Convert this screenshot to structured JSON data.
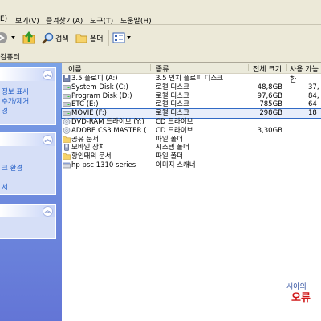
{
  "menu": {
    "items": [
      "E)",
      "보기(V)",
      "즐겨찾기(A)",
      "도구(T)",
      "도움말(H)"
    ]
  },
  "toolbar": {
    "search_label": "검색",
    "folders_label": "폴더"
  },
  "address": {
    "text": "컴퓨터"
  },
  "taskpane": {
    "panel1_links": [
      "정보 표시",
      "추가/제거",
      "경"
    ],
    "panel2_links": [
      "크 환경",
      "서"
    ]
  },
  "columns": {
    "name": "이름",
    "type": "종류",
    "total": "전체 크기",
    "free": "사용 가능한"
  },
  "rows": [
    {
      "name": "3.5 플로피 (A:)",
      "type": "3.5 인치 플로피 디스크",
      "total": "",
      "free": "",
      "icon": "floppy-icon"
    },
    {
      "name": "System Disk (C:)",
      "type": "로컬 디스크",
      "total": "48,8GB",
      "free": "37,",
      "icon": "hard-disk-icon"
    },
    {
      "name": "Program Disk (D:)",
      "type": "로컬 디스크",
      "total": "97,6GB",
      "free": "84,",
      "icon": "hard-disk-icon"
    },
    {
      "name": "ETC (E:)",
      "type": "로컬 디스크",
      "total": "785GB",
      "free": "64",
      "icon": "hard-disk-icon"
    },
    {
      "name": "MOVIE (F:)",
      "type": "로컬 디스크",
      "total": "298GB",
      "free": "18",
      "icon": "hard-disk-icon"
    },
    {
      "name": "DVD-RAM 드라이브 (Y:)",
      "type": "CD 드라이브",
      "total": "",
      "free": "",
      "icon": "cd-drive-icon"
    },
    {
      "name": "ADOBE CS3 MASTER (",
      "type": "CD 드라이브",
      "total": "3,30GB",
      "free": "",
      "icon": "cd-drive-icon"
    },
    {
      "name": "공유 문서",
      "type": "파일 폴더",
      "total": "",
      "free": "",
      "icon": "folder-icon"
    },
    {
      "name": "모바일 장치",
      "type": "시스템 폴더",
      "total": "",
      "free": "",
      "icon": "device-icon"
    },
    {
      "name": "황인태의 문서",
      "type": "파일 폴더",
      "total": "",
      "free": "",
      "icon": "folder-icon"
    },
    {
      "name": "hp psc 1310 series",
      "type": "이미지 스캐너",
      "total": "",
      "free": "",
      "icon": "scanner-icon"
    }
  ],
  "watermark": {
    "line1": "시아의",
    "line2": "오류"
  }
}
